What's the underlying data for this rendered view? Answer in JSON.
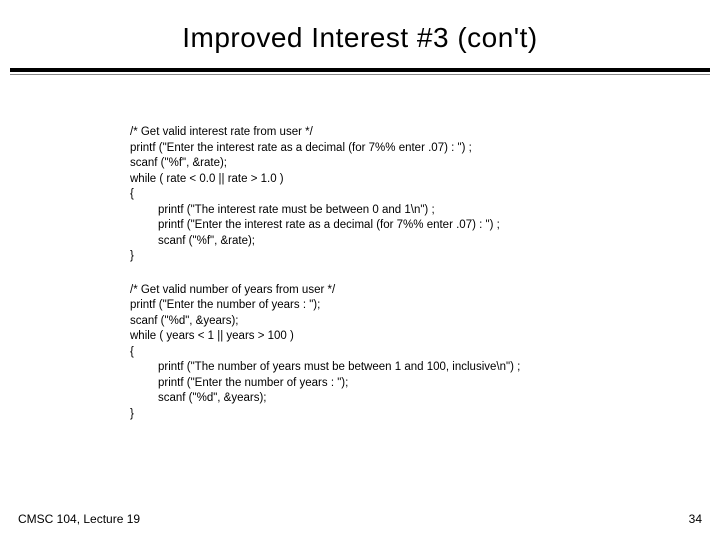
{
  "title": "Improved Interest  #3 (con't)",
  "block1": {
    "l1": "/* Get valid interest rate from user */",
    "l2": "printf (\"Enter the interest rate as a decimal (for 7%% enter .07) : \") ;",
    "l3": "scanf (\"%f\", &rate);",
    "l4": "while ( rate <  0.0 || rate > 1.0 )",
    "l5": "{",
    "l6": "printf (\"The interest rate must be between 0 and 1\\n\") ;",
    "l7": "printf (\"Enter the interest rate as a decimal (for 7%% enter .07) : \") ;",
    "l8": "scanf (\"%f\", &rate);",
    "l9": "}"
  },
  "block2": {
    "l1": "/* Get valid number of years from user */",
    "l2": "printf (\"Enter the number of years : \");",
    "l3": "scanf (\"%d\", &years);",
    "l4": "while ( years <  1 || years > 100 )",
    "l5": "{",
    "l6": "printf (\"The number of years must be between 1 and 100, inclusive\\n\") ;",
    "l7": "printf (\"Enter the number of years : \");",
    "l8": "scanf (\"%d\", &years);",
    "l9": "}"
  },
  "footer": {
    "left": "CMSC 104, Lecture 19",
    "right": "34"
  }
}
